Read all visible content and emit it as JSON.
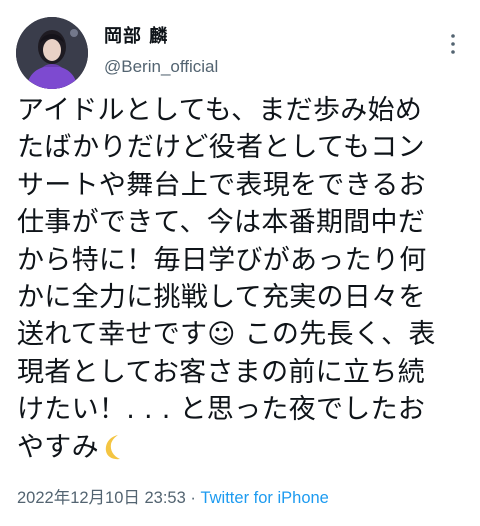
{
  "tweet": {
    "display_name": "岡部 麟",
    "handle": "@Berin_official",
    "text_lines": [
      "アイドルとしても、まだ歩み始め",
      "たばかりだけど役者としてもコン",
      "サートや舞台上で表現をできるお",
      "仕事ができて、今は本番期間中だ",
      "から特に！毎日学びがあったり何",
      "かに全力に挑戦して充実の日々を",
      "送れて幸せです☺︎ この先長く、表",
      "現者としてお客さまの前に立ち続",
      "けたい！. . . と思った夜でしたお",
      "やすみ"
    ],
    "moon_icon": "crescent-moon-emoji",
    "timestamp": "2022年12月10日 23:53",
    "separator": " · ",
    "source": "Twitter for iPhone"
  },
  "colors": {
    "text": "#0f1419",
    "secondary": "#536471",
    "link": "#1d9bf0",
    "moon": "#f4c542"
  },
  "icons": {
    "more": "more-vertical-icon",
    "avatar": "profile-avatar"
  }
}
